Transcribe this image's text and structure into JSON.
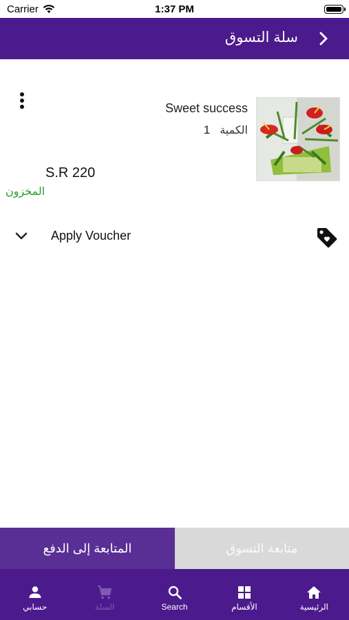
{
  "status_bar": {
    "carrier": "Carrier",
    "time": "1:37 PM"
  },
  "header": {
    "title": "سلة التسوق"
  },
  "cart_item": {
    "name": "Sweet success",
    "quantity_label": "الكمية",
    "quantity": "1",
    "price": "S.R 220",
    "stock_status": "المخزون"
  },
  "voucher": {
    "label": "Apply Voucher"
  },
  "actions": {
    "checkout_label": "المتابعة إلى الدفع",
    "continue_label": "متابعة التسوق"
  },
  "tabs": [
    {
      "label": "حسابي",
      "icon": "person-icon"
    },
    {
      "label": "السلة",
      "icon": "cart-icon"
    },
    {
      "label": "Search",
      "icon": "search-icon"
    },
    {
      "label": "الأقسام",
      "icon": "grid-icon"
    },
    {
      "label": "الرئيسية",
      "icon": "home-icon"
    }
  ],
  "colors": {
    "primary": "#4b1a8c",
    "checkout_bg": "#5a2f95",
    "continue_bg": "#d9d9d9",
    "stock_green": "#27a02a"
  }
}
